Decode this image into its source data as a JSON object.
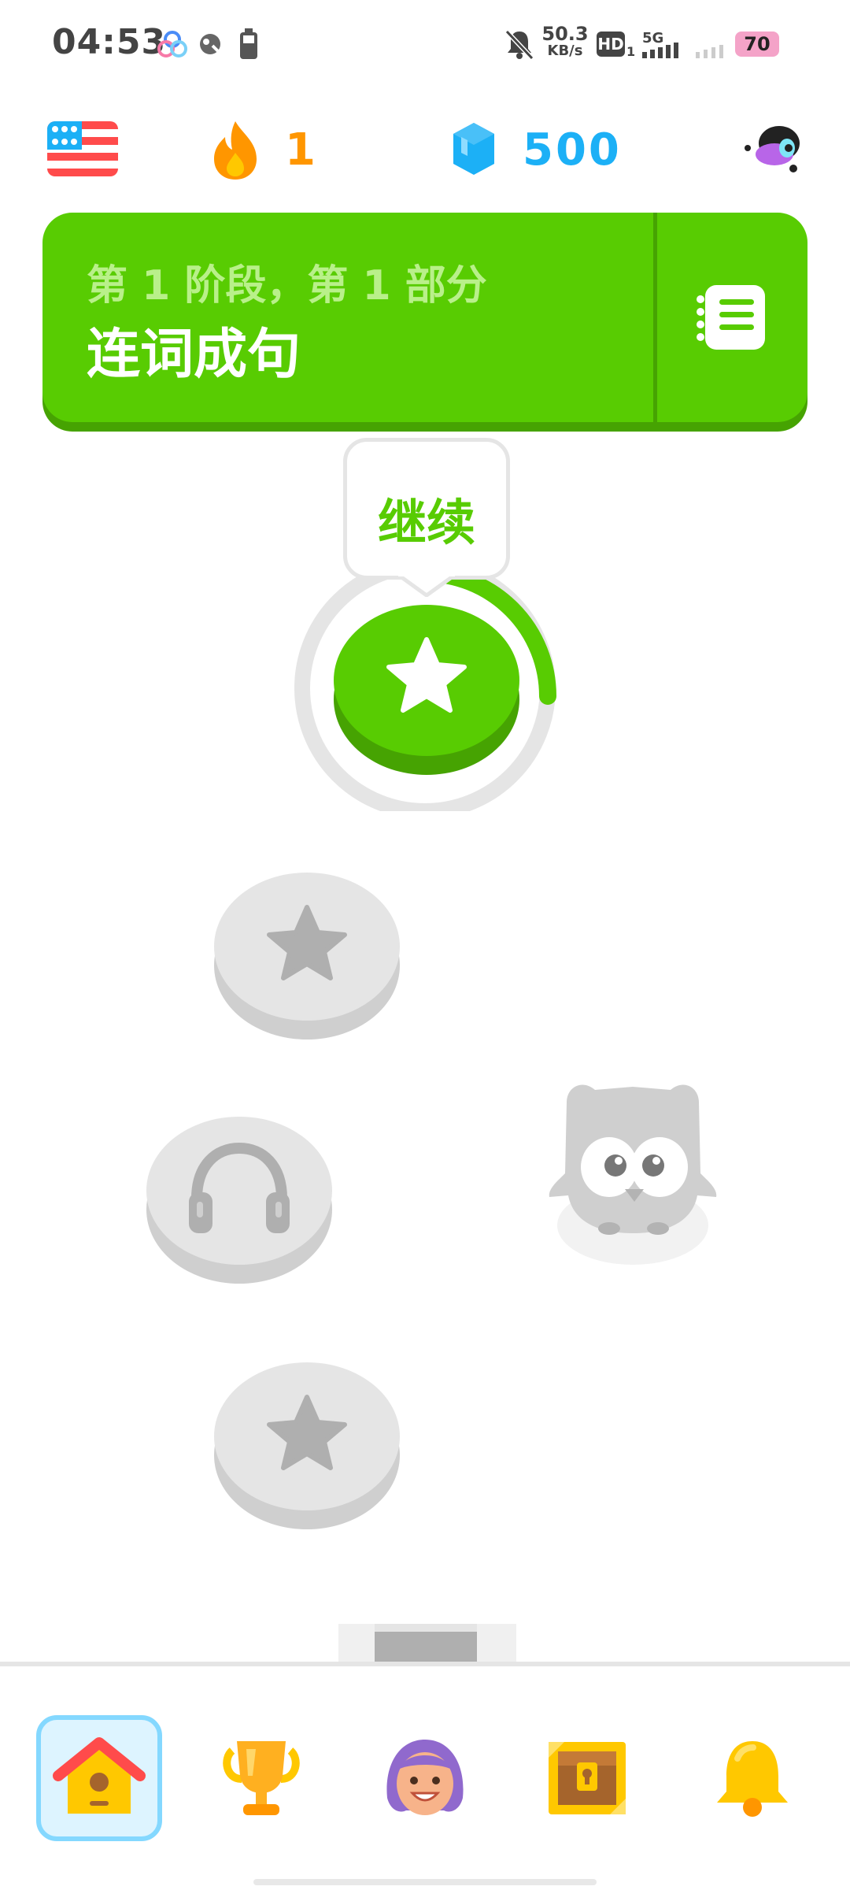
{
  "status_bar": {
    "time": "04:53",
    "network_speed_value": "50.3",
    "network_speed_unit": "KB/s",
    "hd_label": "HD",
    "hd_sub": "1",
    "signal_label": "5G",
    "battery_level": "70"
  },
  "top_bar": {
    "course_flag": "us-flag-icon",
    "streak_count": "1",
    "gems_count": "500"
  },
  "unit": {
    "subtitle": "第 1 阶段，第 1 部分",
    "title": "连词成句"
  },
  "path": {
    "tooltip_label": "继续",
    "nodes": [
      {
        "type": "star",
        "state": "active"
      },
      {
        "type": "star",
        "state": "locked"
      },
      {
        "type": "headphones",
        "state": "locked"
      },
      {
        "type": "star",
        "state": "locked"
      }
    ]
  },
  "tabs": [
    {
      "name": "home",
      "icon": "home-icon",
      "active": true
    },
    {
      "name": "leaderboard",
      "icon": "trophy-icon",
      "active": false
    },
    {
      "name": "profile",
      "icon": "profile-icon",
      "active": false
    },
    {
      "name": "shop",
      "icon": "treasure-chest-icon",
      "active": false
    },
    {
      "name": "notifications",
      "icon": "bell-icon",
      "active": false
    }
  ],
  "colors": {
    "green": "#58cc02",
    "green_dark": "#46a302",
    "orange": "#ff9600",
    "blue": "#1cb0f6",
    "locked_gray": "#e5e5e5"
  }
}
